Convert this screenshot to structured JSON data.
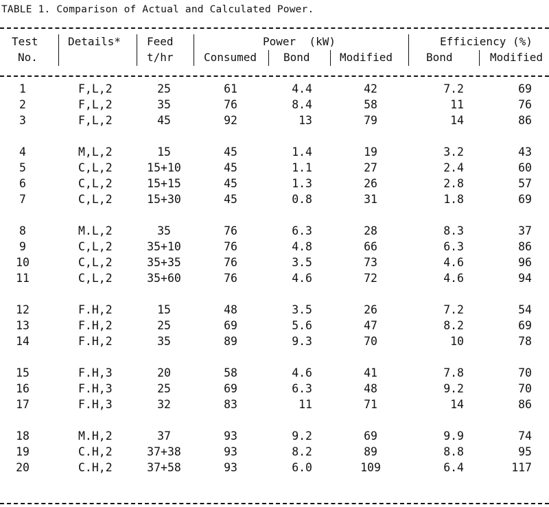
{
  "title": "TABLE 1. Comparison of Actual and Calculated Power.",
  "headers": {
    "test_line1": "Test",
    "test_line2": "No.",
    "details": "Details*",
    "feed_line1": "Feed",
    "feed_line2": "t/hr",
    "power_group": "Power  (kW)",
    "power_consumed": "Consumed",
    "power_bond": "Bond",
    "power_modified": "Modified",
    "efficiency_group": "Efficiency (%)",
    "efficiency_bond": "Bond",
    "efficiency_modified": "Modified"
  },
  "groups": [
    [
      {
        "test": "1",
        "details": "F,L,2",
        "feed": "25",
        "consumed": "61",
        "bond": "4.4",
        "modified": "42",
        "eff_bond": "7.2",
        "eff_modified": "69"
      },
      {
        "test": "2",
        "details": "F,L,2",
        "feed": "35",
        "consumed": "76",
        "bond": "8.4",
        "modified": "58",
        "eff_bond": "11",
        "eff_modified": "76"
      },
      {
        "test": "3",
        "details": "F,L,2",
        "feed": "45",
        "consumed": "92",
        "bond": "13",
        "modified": "79",
        "eff_bond": "14",
        "eff_modified": "86"
      }
    ],
    [
      {
        "test": "4",
        "details": "M,L,2",
        "feed": "15",
        "consumed": "45",
        "bond": "1.4",
        "modified": "19",
        "eff_bond": "3.2",
        "eff_modified": "43"
      },
      {
        "test": "5",
        "details": "C,L,2",
        "feed": "15+10",
        "consumed": "45",
        "bond": "1.1",
        "modified": "27",
        "eff_bond": "2.4",
        "eff_modified": "60"
      },
      {
        "test": "6",
        "details": "C,L,2",
        "feed": "15+15",
        "consumed": "45",
        "bond": "1.3",
        "modified": "26",
        "eff_bond": "2.8",
        "eff_modified": "57"
      },
      {
        "test": "7",
        "details": "C,L,2",
        "feed": "15+30",
        "consumed": "45",
        "bond": "0.8",
        "modified": "31",
        "eff_bond": "1.8",
        "eff_modified": "69"
      }
    ],
    [
      {
        "test": "8",
        "details": "M.L,2",
        "feed": "35",
        "consumed": "76",
        "bond": "6.3",
        "modified": "28",
        "eff_bond": "8.3",
        "eff_modified": "37"
      },
      {
        "test": "9",
        "details": "C,L,2",
        "feed": "35+10",
        "consumed": "76",
        "bond": "4.8",
        "modified": "66",
        "eff_bond": "6.3",
        "eff_modified": "86"
      },
      {
        "test": "10",
        "details": "C,L,2",
        "feed": "35+35",
        "consumed": "76",
        "bond": "3.5",
        "modified": "73",
        "eff_bond": "4.6",
        "eff_modified": "96"
      },
      {
        "test": "11",
        "details": "C,L,2",
        "feed": "35+60",
        "consumed": "76",
        "bond": "4.6",
        "modified": "72",
        "eff_bond": "4.6",
        "eff_modified": "94"
      }
    ],
    [
      {
        "test": "12",
        "details": "F.H,2",
        "feed": "15",
        "consumed": "48",
        "bond": "3.5",
        "modified": "26",
        "eff_bond": "7.2",
        "eff_modified": "54"
      },
      {
        "test": "13",
        "details": "F.H,2",
        "feed": "25",
        "consumed": "69",
        "bond": "5.6",
        "modified": "47",
        "eff_bond": "8.2",
        "eff_modified": "69"
      },
      {
        "test": "14",
        "details": "F.H,2",
        "feed": "35",
        "consumed": "89",
        "bond": "9.3",
        "modified": "70",
        "eff_bond": "10",
        "eff_modified": "78"
      }
    ],
    [
      {
        "test": "15",
        "details": "F.H,3",
        "feed": "20",
        "consumed": "58",
        "bond": "4.6",
        "modified": "41",
        "eff_bond": "7.8",
        "eff_modified": "70"
      },
      {
        "test": "16",
        "details": "F.H,3",
        "feed": "25",
        "consumed": "69",
        "bond": "6.3",
        "modified": "48",
        "eff_bond": "9.2",
        "eff_modified": "70"
      },
      {
        "test": "17",
        "details": "F.H,3",
        "feed": "32",
        "consumed": "83",
        "bond": "11",
        "modified": "71",
        "eff_bond": "14",
        "eff_modified": "86"
      }
    ],
    [
      {
        "test": "18",
        "details": "M.H,2",
        "feed": "37",
        "consumed": "93",
        "bond": "9.2",
        "modified": "69",
        "eff_bond": "9.9",
        "eff_modified": "74"
      },
      {
        "test": "19",
        "details": "C.H,2",
        "feed": "37+38",
        "consumed": "93",
        "bond": "8.2",
        "modified": "89",
        "eff_bond": "8.8",
        "eff_modified": "95"
      },
      {
        "test": "20",
        "details": "C.H,2",
        "feed": "37+58",
        "consumed": "93",
        "bond": "6.0",
        "modified": "109",
        "eff_bond": "6.4",
        "eff_modified": "117"
      }
    ]
  ]
}
